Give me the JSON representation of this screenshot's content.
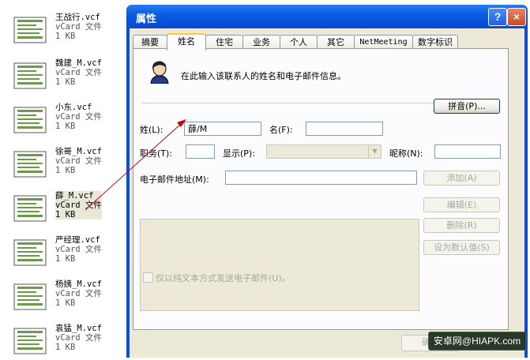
{
  "files": [
    {
      "name": "王战行.vcf",
      "type": "vCard 文件",
      "size": "1 KB"
    },
    {
      "name": "魏建_M.vcf",
      "type": "vCard 文件",
      "size": "1 KB"
    },
    {
      "name": "小东.vcf",
      "type": "vCard 文件",
      "size": "1 KB"
    },
    {
      "name": "徐哥_M.vcf",
      "type": "vCard 文件",
      "size": "1 KB"
    },
    {
      "name": "薛_M.vcf",
      "type": "vCard 文件",
      "size": "1 KB"
    },
    {
      "name": "严经理.vcf",
      "type": "vCard 文件",
      "size": "1 KB"
    },
    {
      "name": "杨姨_M.vcf",
      "type": "vCard 文件",
      "size": "1 KB"
    },
    {
      "name": "袁猛_M.vcf",
      "type": "vCard 文件",
      "size": "1 KB"
    }
  ],
  "dialog": {
    "title": "属性",
    "help": "?",
    "close": "×",
    "tabs": [
      "摘要",
      "姓名",
      "住宅",
      "业务",
      "个人",
      "其它",
      "NetMeeting",
      "数字标识"
    ],
    "intro": "在此输入该联系人的姓名和电子邮件信息。",
    "pinyin_button": "拼音(P)...",
    "last_name_label": "姓(L):",
    "last_name_value": "薛/M",
    "first_name_label": "名(F):",
    "first_name_value": "",
    "title_label": "职务(T):",
    "display_label": "显示(P):",
    "nickname_label": "昵称(N):",
    "email_label": "电子邮件地址(M):",
    "add_button": "添加(A)",
    "edit_button": "编辑(E)",
    "delete_button": "删除(R)",
    "default_button": "设为默认值(S)",
    "plain_text_label": "仅以纯文本方式发送电子邮件(U)。",
    "ok_button": "确定"
  },
  "watermark": "安卓网@HIAPK.com",
  "colors": {
    "titlebar": "#0a5ae0",
    "client": "#ece9d8",
    "arrow": "#cc0000",
    "tab_highlight": "#ffc83c"
  }
}
